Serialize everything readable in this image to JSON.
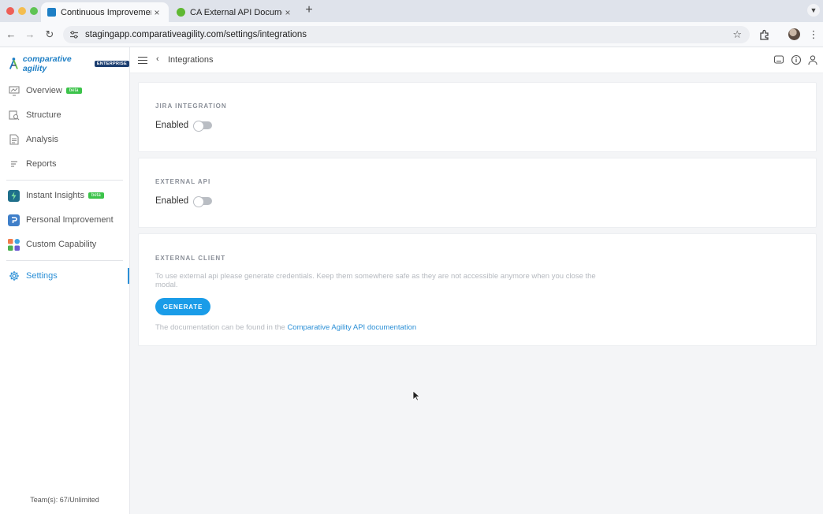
{
  "browser": {
    "tabs": [
      {
        "title": "Continuous Improvement and",
        "favicon_color": "#1e7fc5",
        "active": true
      },
      {
        "title": "CA External API Documentati",
        "favicon_color": "#5fb832",
        "active": false
      }
    ],
    "new_tab_glyph": "+",
    "url": "stagingapp.comparativeagility.com/settings/integrations"
  },
  "sidebar": {
    "logo_text": "comparative agility",
    "logo_badge": "ENTERPRISE",
    "items": [
      {
        "label": "Overview",
        "badge": "beta",
        "icon": "monitor-icon"
      },
      {
        "label": "Structure",
        "icon": "structure-icon"
      },
      {
        "label": "Analysis",
        "icon": "document-icon"
      },
      {
        "label": "Reports",
        "icon": "list-icon"
      },
      {
        "label": "Instant Insights",
        "badge": "beta",
        "icon": "lightning-icon"
      },
      {
        "label": "Personal Improvement",
        "icon": "personal-improvement-icon"
      },
      {
        "label": "Custom Capability",
        "icon": "capability-grid-icon"
      },
      {
        "label": "Settings",
        "icon": "gear-icon",
        "active": true
      }
    ],
    "team_count": "Team(s): 67/Unlimited"
  },
  "topbar": {
    "title": "Integrations"
  },
  "cards": {
    "jira": {
      "title": "JIRA INTEGRATION",
      "toggle_label": "Enabled",
      "enabled": false
    },
    "external_api": {
      "title": "EXTERNAL API",
      "toggle_label": "Enabled",
      "enabled": false
    },
    "external_client": {
      "title": "EXTERNAL CLIENT",
      "help_text": "To use external api please generate credentials. Keep them somewhere safe as they are not accessible anymore when you close the modal.",
      "button_label": "GENERATE",
      "doc_prefix": "The documentation can be found in the",
      "doc_link": "Comparative Agility API documentation"
    }
  },
  "colors": {
    "accent": "#2b8fd6",
    "button": "#1a9ce8",
    "beta_badge": "#3cc34a"
  }
}
